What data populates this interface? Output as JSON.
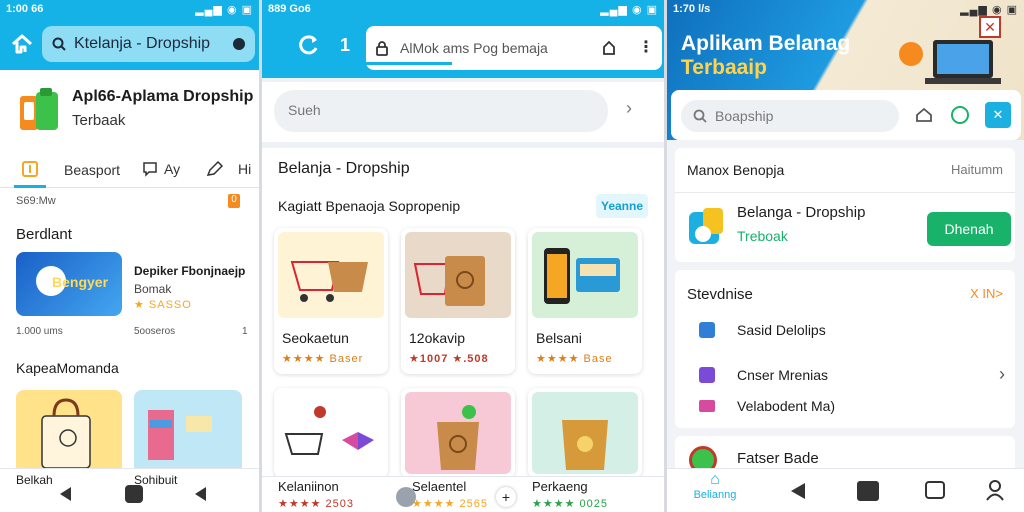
{
  "panel1": {
    "status": {
      "time": "1:00 66",
      "icons": "▂▄▆ ◉ ▣"
    },
    "search_text": "Ktelanja - Dropship",
    "app": {
      "title": "Apl66-Aplama Dropship",
      "subtitle": "Terbaak"
    },
    "tabs": [
      {
        "label": "Beasport"
      },
      {
        "label": "Ay"
      },
      {
        "label": "Hi"
      }
    ],
    "meta_left": "S69:Mw",
    "meta_right": "0",
    "section1": "Berdlant",
    "banner_text": "Bengyer",
    "featured": {
      "title": "Depiker Fbonjnaejp",
      "line1": "Bomak",
      "line2": "★ SASSO"
    },
    "stats_left": "1.000 ums",
    "stats_mid": "5ooseros",
    "stats_right": "1",
    "section2": "KapeaMomanda",
    "bottom_label": "Belkah",
    "bottom_label2": "Sohibuit"
  },
  "panel2": {
    "status": {
      "time": "889 Go6",
      "icons": "▂▄▆ ◉ ▣"
    },
    "url": "AlMok ams Pog bemaja",
    "search_placeholder": "Sueh",
    "page_title": "Belanja - Dropship",
    "section_title": "Kagiatt Bpenaoja Sopropenip",
    "section_link": "Yeanne",
    "products": [
      {
        "name": "Seokaetun",
        "rating": "★★★★ Baser",
        "color": "#fff3d6"
      },
      {
        "name": "12okavip",
        "rating": "★1007 ★.508",
        "color": "#e8d9c8"
      },
      {
        "name": "Belsani",
        "rating": "★★★★ Base",
        "color": "#d6f0d8"
      }
    ],
    "bottom_products": [
      {
        "name": "Kelaniinon",
        "rating": "★★★★ 2503"
      },
      {
        "name": "Selaentel",
        "rating": "★★★★ 2565"
      },
      {
        "name": "Perkaeng",
        "rating": "★★★★ 0025"
      }
    ]
  },
  "panel3": {
    "status": {
      "time": "1:70 l/s",
      "icons": "▂▄▆ ◉ ▣"
    },
    "banner_title": "Aplikam Belanag",
    "banner_sub": "Terbaaip",
    "search_placeholder": "Boapship",
    "section1": {
      "left": "Manox Benopja",
      "right": "Haitumm"
    },
    "app": {
      "title": "Belanga - Dropship",
      "subtitle": "Treboak"
    },
    "download_btn": "Dhenah",
    "section2": {
      "left": "Stevdnise",
      "right": "X IN>"
    },
    "list": [
      {
        "label": "Sasid Delolips",
        "color": "#2f7fd6"
      },
      {
        "label": "Cnser Mrenias",
        "color": "#7b4ad6"
      },
      {
        "label": "Velabodent Ma)",
        "color": "#d64aa0"
      }
    ],
    "faster": "Fatser Bade",
    "nav_label": "Belianng"
  }
}
